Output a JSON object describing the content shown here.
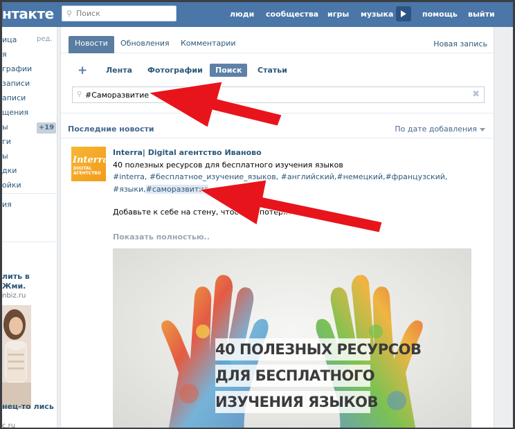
{
  "header": {
    "logo_text": "нтакте",
    "search_placeholder": "Поиск",
    "nav": [
      "люди",
      "сообщества",
      "игры",
      "музыка",
      "помощь",
      "выйти"
    ],
    "color": "#4a76a8"
  },
  "leftnav": {
    "items": [
      "ица",
      "я",
      "графии",
      "записи",
      "аписи",
      "щения",
      "ы",
      "ги",
      "ы",
      "дки",
      "ойки",
      "ия"
    ],
    "edit_label": "ред.",
    "badge": "+19",
    "ad_title": "лить в Жми.",
    "ad_domain": "nbiz.ru",
    "ad2_title": "нец-то лись",
    "ad2_domain": "c.ru"
  },
  "tabs": {
    "items": [
      "Новости",
      "Обновления",
      "Комментарии"
    ],
    "active": "Новости",
    "new_post": "Новая запись"
  },
  "subnav": {
    "items": [
      "Лента",
      "Фотографии",
      "Поиск",
      "Статьи"
    ],
    "active": "Поиск"
  },
  "hashtag_search": {
    "value": "#Саморазвитие"
  },
  "feed": {
    "heading": "Последние новости",
    "sort_label": "По дате добавления"
  },
  "post": {
    "avatar_brand": "Interra",
    "avatar_sub": "DIGITAL АГЕНТСТВО",
    "author": "Interra| Digital агентство Иваново",
    "line1": "40 полезных ресурсов для бесплатного изучения языков",
    "tags_line1": "#interra, #бесплатное_изучение_языков, #английский,#немецкий,#французский,",
    "tags_line2_prefix": "#языки,",
    "tags_line2_highlight": "#саморазвитие",
    "line3": "Добавьте к себе на стену, чтобы не потерять .",
    "show_full": "Показать полностью..",
    "image_lines": [
      "40 ПОЛЕЗНЫХ РЕСУРСОВ",
      "ДЛЯ БЕСПЛАТНОГО",
      "ИЗУЧЕНИЯ ЯЗЫКОВ"
    ]
  },
  "annotations": {
    "arrow_color": "#e8141b"
  }
}
